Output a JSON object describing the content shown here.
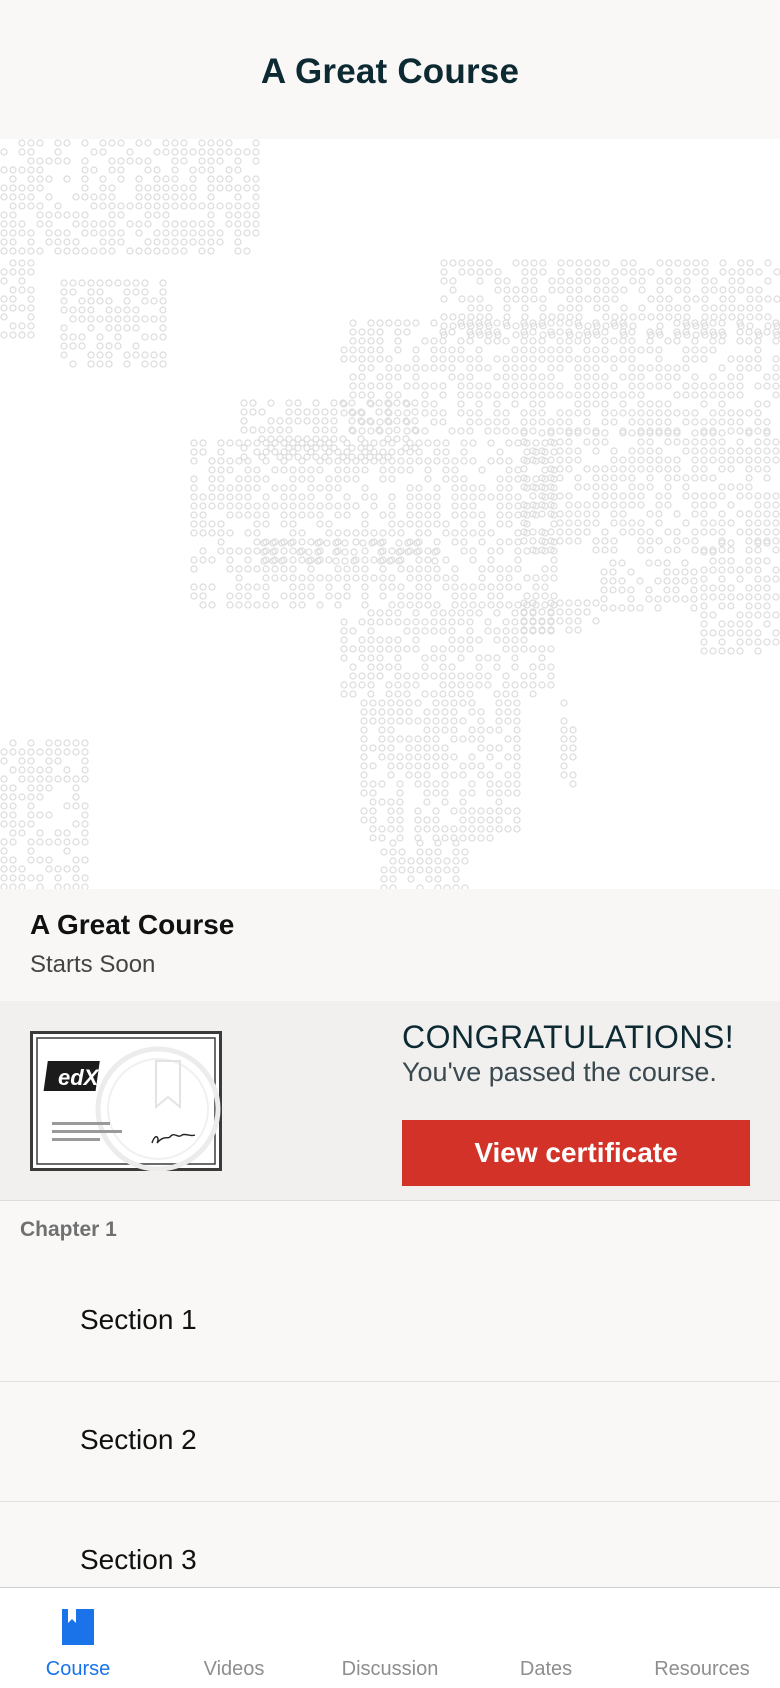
{
  "header": {
    "title": "A Great Course"
  },
  "course": {
    "name": "A Great Course",
    "status": "Starts Soon"
  },
  "certificate": {
    "heading": "CONGRATULATIONS!",
    "message": "You've passed the course.",
    "button_label": "View certificate",
    "logo_text": "edX",
    "button_color": "#d23228"
  },
  "outline": {
    "chapter_title": "Chapter 1",
    "sections": [
      {
        "label": "Section 1"
      },
      {
        "label": "Section 2"
      },
      {
        "label": "Section 3"
      }
    ]
  },
  "tabs": [
    {
      "label": "Course",
      "icon": "course-icon",
      "active": true
    },
    {
      "label": "Videos",
      "active": false
    },
    {
      "label": "Discussion",
      "active": false
    },
    {
      "label": "Dates",
      "active": false
    },
    {
      "label": "Resources",
      "active": false
    }
  ],
  "colors": {
    "accent": "#1a73e8",
    "title": "#0d2a33"
  }
}
